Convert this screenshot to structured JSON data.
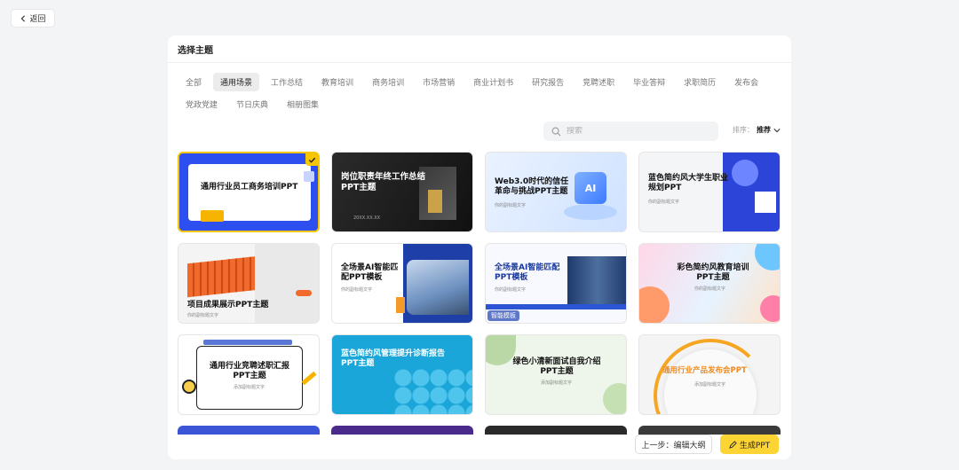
{
  "back_label": "返回",
  "panel_title": "选择主题",
  "categories": [
    "全部",
    "通用场景",
    "工作总结",
    "教育培训",
    "商务培训",
    "市场营销",
    "商业计划书",
    "研究报告",
    "竞聘述职",
    "毕业答辩",
    "求职简历",
    "发布会",
    "党政党建",
    "节日庆典",
    "相册图集"
  ],
  "active_category": "通用场景",
  "search": {
    "placeholder": "搜索",
    "value": ""
  },
  "sort": {
    "label": "排序：",
    "value": "推荐"
  },
  "templates": [
    {
      "title": "通用行业员工商务培训PPT",
      "selected": true
    },
    {
      "title": "岗位职责年终工作总结PPT主题",
      "date": "20XX.XX.XX"
    },
    {
      "title": "Web3.0时代的信任革命与挑战PPT主题",
      "sub": "你的副标题文字",
      "icon": "AI"
    },
    {
      "title": "蓝色简约风大学生职业规划PPT",
      "sub": "你的副标题文字"
    },
    {
      "title": "项目成果展示PPT主题",
      "sub": "你的副标题文字"
    },
    {
      "title": "全场景AI智能匹配PPT模板",
      "sub": "你的副标题文字"
    },
    {
      "title": "全场景AI智能匹配PPT模板",
      "sub": "你的副标题文字",
      "badge": "智能模板"
    },
    {
      "title": "彩色简约风教育培训PPT主题",
      "sub": "你的副标题文字"
    },
    {
      "title": "通用行业竞聘述职汇报PPT主题",
      "sub": "添加副标题文字"
    },
    {
      "title": "蓝色简约风管理提升诊断报告PPT主题"
    },
    {
      "title": "绿色小清新面试自我介绍PPT主题",
      "sub": "添加副标题文字"
    },
    {
      "title": "通用行业产品发布会PPT",
      "sub": "添加副标题文字"
    }
  ],
  "footer": {
    "prev_label": "上一步：编辑大纲",
    "generate_label": "生成PPT"
  },
  "colors": {
    "accent": "#f6c700",
    "generate_bg": "#fcd535"
  }
}
